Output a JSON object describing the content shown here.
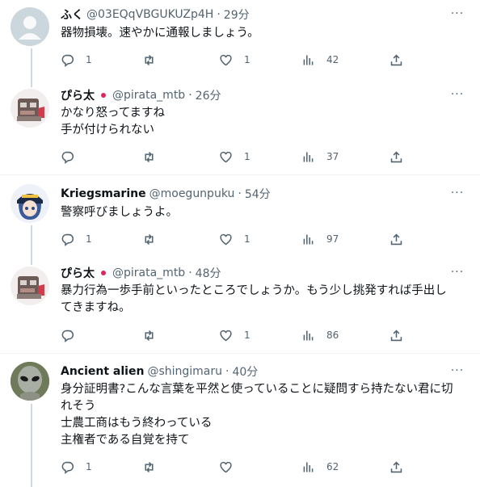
{
  "tweets": [
    {
      "name": "ふく",
      "handle": "@03EQqVBGUKUZp4H",
      "time": "29分",
      "text": "器物損壊。速やかに通報しましょう。",
      "replies": "1",
      "retweets": "",
      "likes": "1",
      "views": "42",
      "avatar": "default-avatar"
    },
    {
      "name": "ぴら太",
      "handle": "@pirata_mtb",
      "time": "26分",
      "text": "かなり怒ってますね\n手が付けられない",
      "replies": "",
      "retweets": "",
      "likes": "1",
      "views": "37",
      "avatar": "robot-avatar"
    },
    {
      "name": "Kriegsmarine",
      "handle": "@moegunpuku",
      "time": "54分",
      "text": "警察呼びましょうよ。",
      "replies": "1",
      "retweets": "",
      "likes": "1",
      "views": "97",
      "avatar": "anime-avatar"
    },
    {
      "name": "ぴら太",
      "handle": "@pirata_mtb",
      "time": "48分",
      "text": "暴力行為一歩手前といったところでしょうか。もう少し挑発すれば手出し\nてきますね。",
      "replies": "",
      "retweets": "",
      "likes": "1",
      "views": "86",
      "avatar": "robot-avatar"
    },
    {
      "name": "Ancient alien",
      "handle": "@shingimaru",
      "time": "40分",
      "text": "身分証明書?こんな言葉を平然と使っていることに疑問すら持たない君に切\nれそう\n士農工商はもう終わっている\n主権者である自覚を持て",
      "replies": "1",
      "retweets": "",
      "likes": "",
      "views": "62",
      "avatar": "alien-avatar"
    }
  ],
  "separator": "·",
  "more_label": "···"
}
